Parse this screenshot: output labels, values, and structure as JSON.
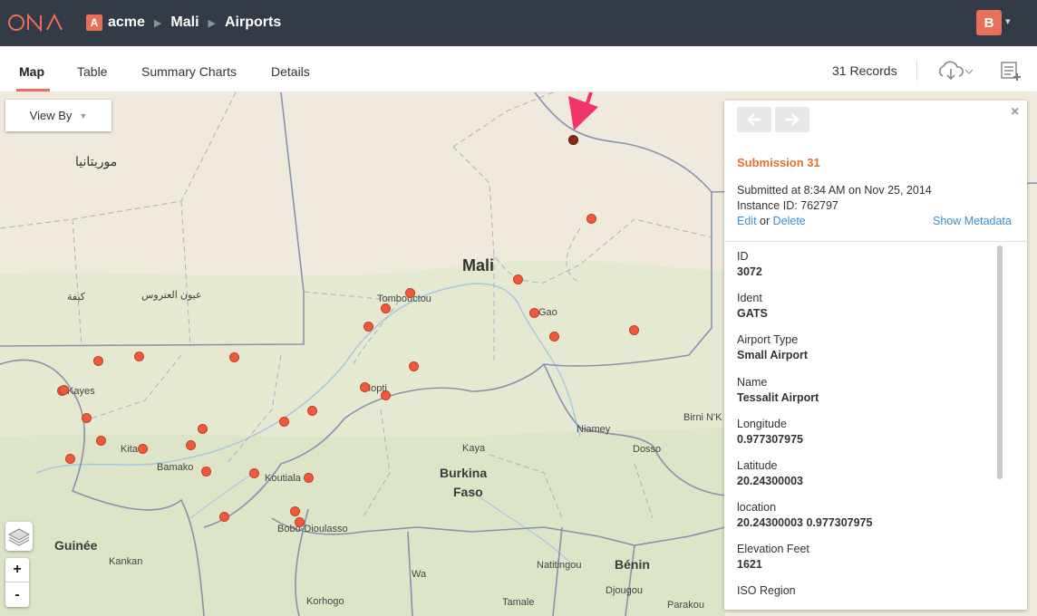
{
  "header": {
    "logo_text": "ONA",
    "org_badge": "A",
    "crumbs": [
      "acme",
      "Mali",
      "Airports"
    ],
    "avatar_initial": "B",
    "colors": {
      "bar": "#333a48",
      "accent": "#e8705a"
    }
  },
  "tabs": [
    "Map",
    "Table",
    "Summary Charts",
    "Details"
  ],
  "records_label": "31 Records",
  "map": {
    "view_by_label": "View By",
    "zoom_in": "+",
    "zoom_out": "-",
    "labels": {
      "mauritania": "موريتانيا",
      "mali": "Mali",
      "kifa": "كيفة",
      "ayoun": "عيون العتروس",
      "tombouctou": "Tombouctou",
      "gao": "Gao",
      "mopti": "Mopti",
      "kayes": "Kayes",
      "kita": "Kita",
      "bamako": "Bamako",
      "koutiala": "Koutiala",
      "bobo": "Bobo-Dioulasso",
      "guinee": "Guinée",
      "kankan": "Kankan",
      "korhogo": "Korhogo",
      "burkina1": "Burkina",
      "burkina2": "Faso",
      "kaya": "Kaya",
      "niamey": "Niamey",
      "dosso": "Dosso",
      "birni": "Birni N'K",
      "wa": "Wa",
      "tamale": "Tamale",
      "natitingou": "Natitingou",
      "benin": "Bénin",
      "djougou": "Djougou",
      "parakou": "Parakou"
    },
    "airport_count": 31,
    "marker_color": "#ef5a3a",
    "selected_marker_color": "#8b2a18",
    "arrow_color": "#f0356a"
  },
  "panel": {
    "prev_icon": "arrow-left-icon",
    "next_icon": "arrow-right-icon",
    "close": "×",
    "title": "Submission 31",
    "submitted": "Submitted at 8:34 AM on Nov 25, 2014",
    "instance": "Instance ID: 762797",
    "edit": "Edit",
    "or": " or ",
    "delete": "Delete",
    "show_metadata": "Show Metadata",
    "fields": [
      {
        "label": "ID",
        "value": "3072"
      },
      {
        "label": "Ident",
        "value": "GATS"
      },
      {
        "label": "Airport Type",
        "value": "Small Airport"
      },
      {
        "label": "Name",
        "value": "Tessalit Airport"
      },
      {
        "label": "Longitude",
        "value": "0.977307975"
      },
      {
        "label": "Latitude",
        "value": "20.24300003"
      },
      {
        "label": "location",
        "value": "20.24300003 0.977307975"
      },
      {
        "label": "Elevation Feet",
        "value": "1621"
      },
      {
        "label": "ISO Region",
        "value": ""
      }
    ],
    "title_color": "#e8702a",
    "link_color": "#3a8fd0"
  }
}
